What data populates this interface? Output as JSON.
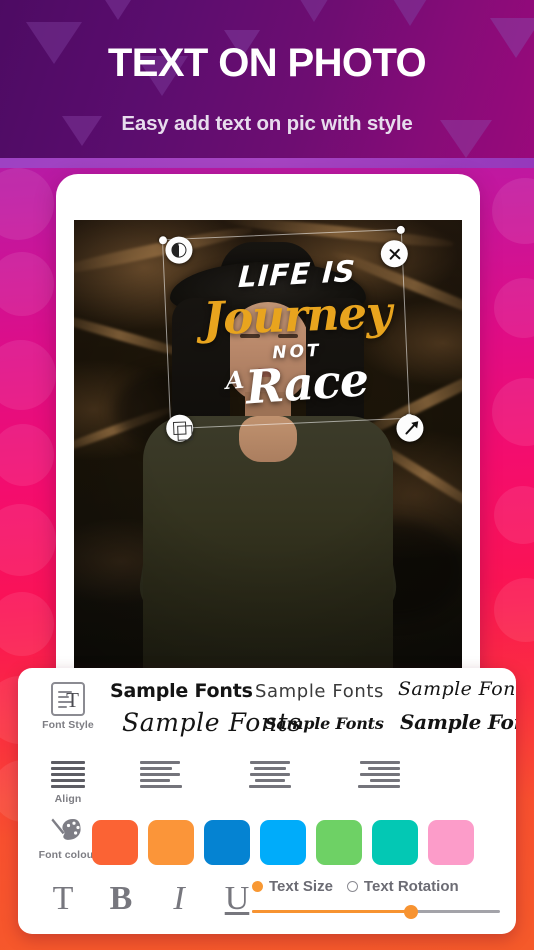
{
  "header": {
    "title": "TEXT ON PHOTO",
    "subtitle": "Easy add text on pic with style"
  },
  "canvas": {
    "artwork": {
      "line1": "LIFE IS",
      "line2": "Journey",
      "line3": "NOT",
      "line4_small": "A",
      "line4": "Race"
    },
    "handles": {
      "opacity": "opacity-handle",
      "close": "close-handle",
      "duplicate": "duplicate-handle",
      "resize": "resize-handle"
    }
  },
  "panel": {
    "font_style": {
      "label": "Font Style",
      "icon": "font-style-icon",
      "samples": [
        "Sample Fonts",
        "Sample Fonts",
        "Sample Fonts",
        "Sample Fonts",
        "Sample Fonts",
        "Sample Fonts"
      ]
    },
    "align": {
      "label": "Align",
      "options": [
        "justify",
        "left",
        "center",
        "right"
      ]
    },
    "font_colour": {
      "label": "Font colour",
      "icon": "palette-icon",
      "swatches": [
        "#fb6334",
        "#fb9539",
        "#0583d2",
        "#00acfa",
        "#6ed165",
        "#03c8b4",
        "#fc9cc9"
      ]
    },
    "text_styles": [
      {
        "name": "normal",
        "glyph": "T"
      },
      {
        "name": "bold",
        "glyph": "B"
      },
      {
        "name": "italic",
        "glyph": "I"
      },
      {
        "name": "underline",
        "glyph": "U"
      }
    ],
    "slider_modes": {
      "text_size": "Text Size",
      "text_rotation": "Text Rotation",
      "selected": "text_size",
      "value_percent": 64
    }
  },
  "colors": {
    "accent_orange": "#f79331",
    "header_purple": "#5b0d6e",
    "artwork_yellow": "#e8a41e"
  }
}
